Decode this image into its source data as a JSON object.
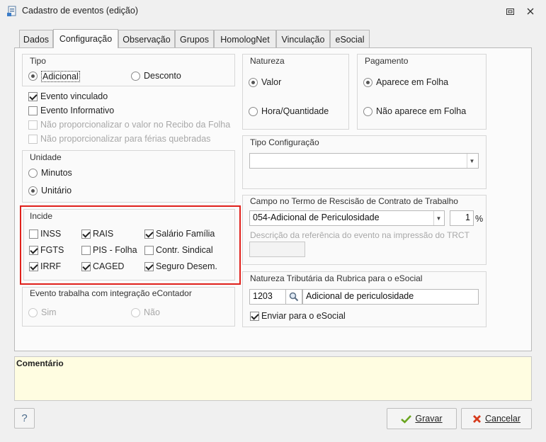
{
  "window": {
    "title": "Cadastro de eventos (edição)",
    "icons": {
      "app": "form-app-icon",
      "restore": "restore-icon",
      "close": "close-icon"
    }
  },
  "tabs": [
    {
      "label": "Dados",
      "active": false
    },
    {
      "label": "Configuração",
      "active": true
    },
    {
      "label": "Observação",
      "active": false
    },
    {
      "label": "Grupos",
      "active": false
    },
    {
      "label": "HomologNet",
      "active": false
    },
    {
      "label": "Vinculação",
      "active": false
    },
    {
      "label": "eSocial",
      "active": false
    }
  ],
  "tipo": {
    "title": "Tipo",
    "options": [
      {
        "label": "Adicional",
        "selected": true
      },
      {
        "label": "Desconto",
        "selected": false
      }
    ]
  },
  "flags": [
    {
      "label": "Evento vinculado",
      "checked": true,
      "disabled": false
    },
    {
      "label": "Evento Informativo",
      "checked": false,
      "disabled": false
    },
    {
      "label": "Não proporcionalizar o valor no Recibo da Folha",
      "checked": false,
      "disabled": true
    },
    {
      "label": "Não proporcionalizar para férias quebradas",
      "checked": false,
      "disabled": true
    }
  ],
  "unidade": {
    "title": "Unidade",
    "options": [
      {
        "label": "Minutos",
        "selected": false
      },
      {
        "label": "Unitário",
        "selected": true
      }
    ]
  },
  "incide": {
    "title": "Incide",
    "items": [
      {
        "label": "INSS",
        "checked": false
      },
      {
        "label": "RAIS",
        "checked": true
      },
      {
        "label": "Salário Família",
        "checked": true
      },
      {
        "label": "FGTS",
        "checked": true
      },
      {
        "label": "PIS - Folha",
        "checked": false
      },
      {
        "label": "Contr. Sindical",
        "checked": false
      },
      {
        "label": "IRRF",
        "checked": true
      },
      {
        "label": "CAGED",
        "checked": true
      },
      {
        "label": "Seguro Desem.",
        "checked": true
      }
    ]
  },
  "econtador": {
    "title": "Evento trabalha com integração eContador",
    "options": [
      {
        "label": "Sim",
        "selected": false
      },
      {
        "label": "Não",
        "selected": false
      }
    ]
  },
  "natureza": {
    "title": "Natureza",
    "options": [
      {
        "label": "Valor",
        "selected": true
      },
      {
        "label": "Hora/Quantidade",
        "selected": false
      }
    ]
  },
  "pagamento": {
    "title": "Pagamento",
    "options": [
      {
        "label": "Aparece em Folha",
        "selected": true
      },
      {
        "label": "Não aparece em Folha",
        "selected": false
      }
    ]
  },
  "tipo_config": {
    "title": "Tipo Configuração",
    "value": ""
  },
  "rescisao": {
    "title": "Campo no Termo de Rescisão de Contrato de Trabalho",
    "select_value": "054-Adicional de Periculosidade",
    "number_value": "1",
    "percent": "%",
    "desc_label": "Descrição da referência do evento na impressão do TRCT",
    "desc_value": ""
  },
  "tributaria": {
    "title": "Natureza Tributária da Rubrica para o eSocial",
    "code": "1203",
    "description": "Adicional de periculosidade",
    "send_label": "Enviar para o eSocial",
    "send_checked": true
  },
  "comment": {
    "label": "Comentário"
  },
  "footer": {
    "help_label": "?",
    "save_label": "Gravar",
    "cancel_label": "Cancelar"
  },
  "colors": {
    "highlight": "#e0201b",
    "comment_bg": "#fffde1",
    "save_check": "#6aa51f",
    "cancel_x": "#d63a1c"
  }
}
